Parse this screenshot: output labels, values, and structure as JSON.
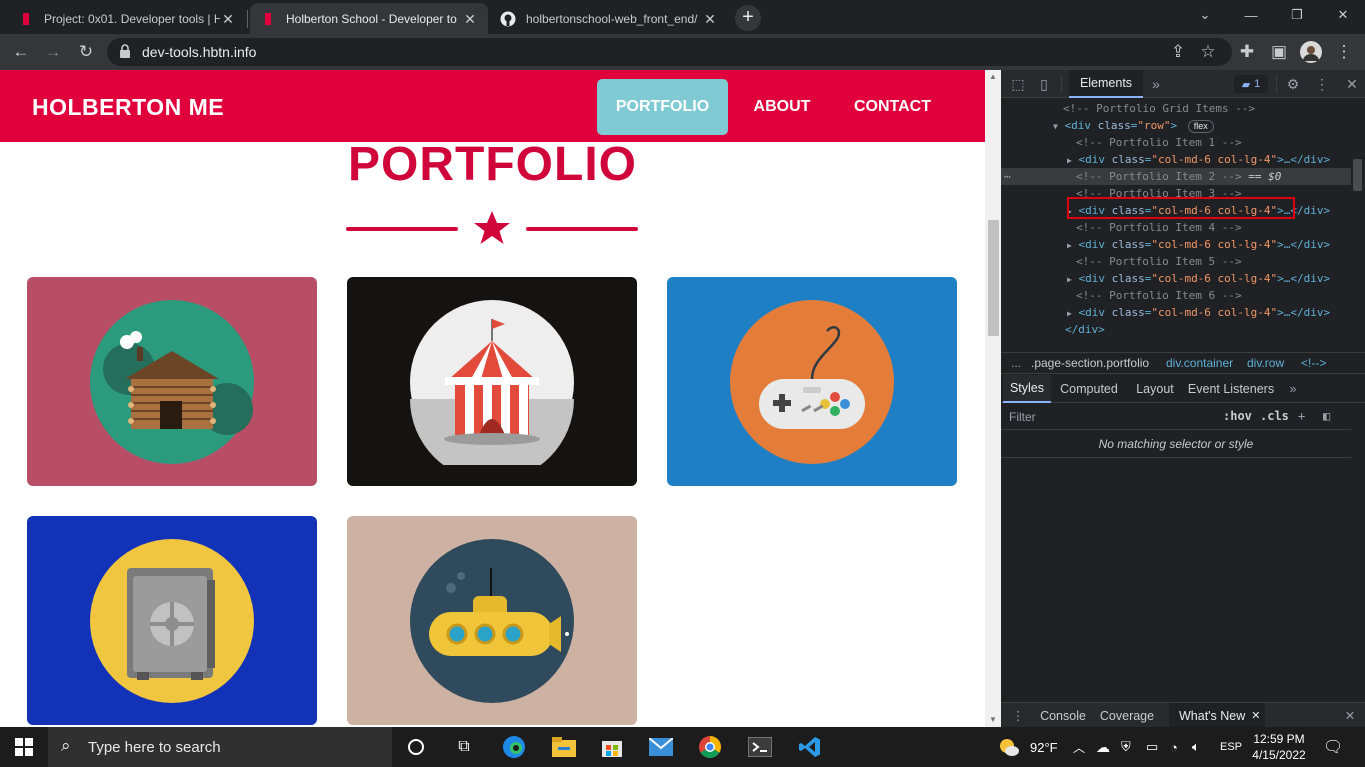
{
  "browser": {
    "tabs": [
      {
        "title": "Project: 0x01. Developer tools | H",
        "active": false
      },
      {
        "title": "Holberton School - Developer to",
        "active": true
      },
      {
        "title": "holbertonschool-web_front_end/",
        "active": false
      }
    ],
    "url": "dev-tools.hbtn.info"
  },
  "site": {
    "brand": "HOLBERTON ME",
    "nav": {
      "portfolio": "PORTFOLIO",
      "about": "ABOUT",
      "contact": "CONTACT"
    },
    "section_title": "PORTFOLIO",
    "cards": [
      {
        "name": "cabin",
        "bg": "#b84e66"
      },
      {
        "name": "circus-tent",
        "bg": "#151212"
      },
      {
        "name": "game-controller",
        "bg": "#1e7fc4"
      },
      {
        "name": "safe",
        "bg": "#1233b8"
      },
      {
        "name": "submarine",
        "bg": "#cdb1a2"
      }
    ]
  },
  "devtools": {
    "tabs": {
      "elements": "Elements",
      "issues_count": "1"
    },
    "dom": {
      "grid_comment": "<!-- Portfolio Grid Items -->",
      "row_open_tag": "<div",
      "row_attr_name": "class",
      "row_attr_value": "\"row\"",
      "row_close": ">",
      "flex_badge": "flex",
      "item1": "<!-- Portfolio Item 1 -->",
      "item2": "<!-- Portfolio Item 2 -->",
      "item2_suffix": "== $0",
      "item3": "<!-- Portfolio Item 3 -->",
      "item4": "<!-- Portfolio Item 4 -->",
      "item5": "<!-- Portfolio Item 5 -->",
      "item6": "<!-- Portfolio Item 6 -->",
      "div_tag": "<div",
      "attr_class": "class",
      "attr_value": "\"col-md-6 col-lg-4\"",
      "collapsed": ">…</div>",
      "div_close": "</div>"
    },
    "breadcrumbs": {
      "ellipsis": "...",
      "section": ".page-section.portfolio",
      "container": "div.container",
      "row": "div.row",
      "comment": "<!--> "
    },
    "subtabs": {
      "styles": "Styles",
      "computed": "Computed",
      "layout": "Layout",
      "event_listeners": "Event Listeners"
    },
    "filter_placeholder": "Filter",
    "hov": ":hov",
    "cls": ".cls",
    "no_match": "No matching selector or style",
    "drawer": {
      "console": "Console",
      "coverage": "Coverage",
      "whats_new": "What's New"
    }
  },
  "taskbar": {
    "search_placeholder": "Type here to search",
    "temperature": "92°F",
    "language": "ESP",
    "time": "12:59 PM",
    "date": "4/15/2022"
  },
  "colors": {
    "brand_red": "#e0003c",
    "accent_teal": "#7fcad3",
    "title_red": "#d0063b"
  }
}
